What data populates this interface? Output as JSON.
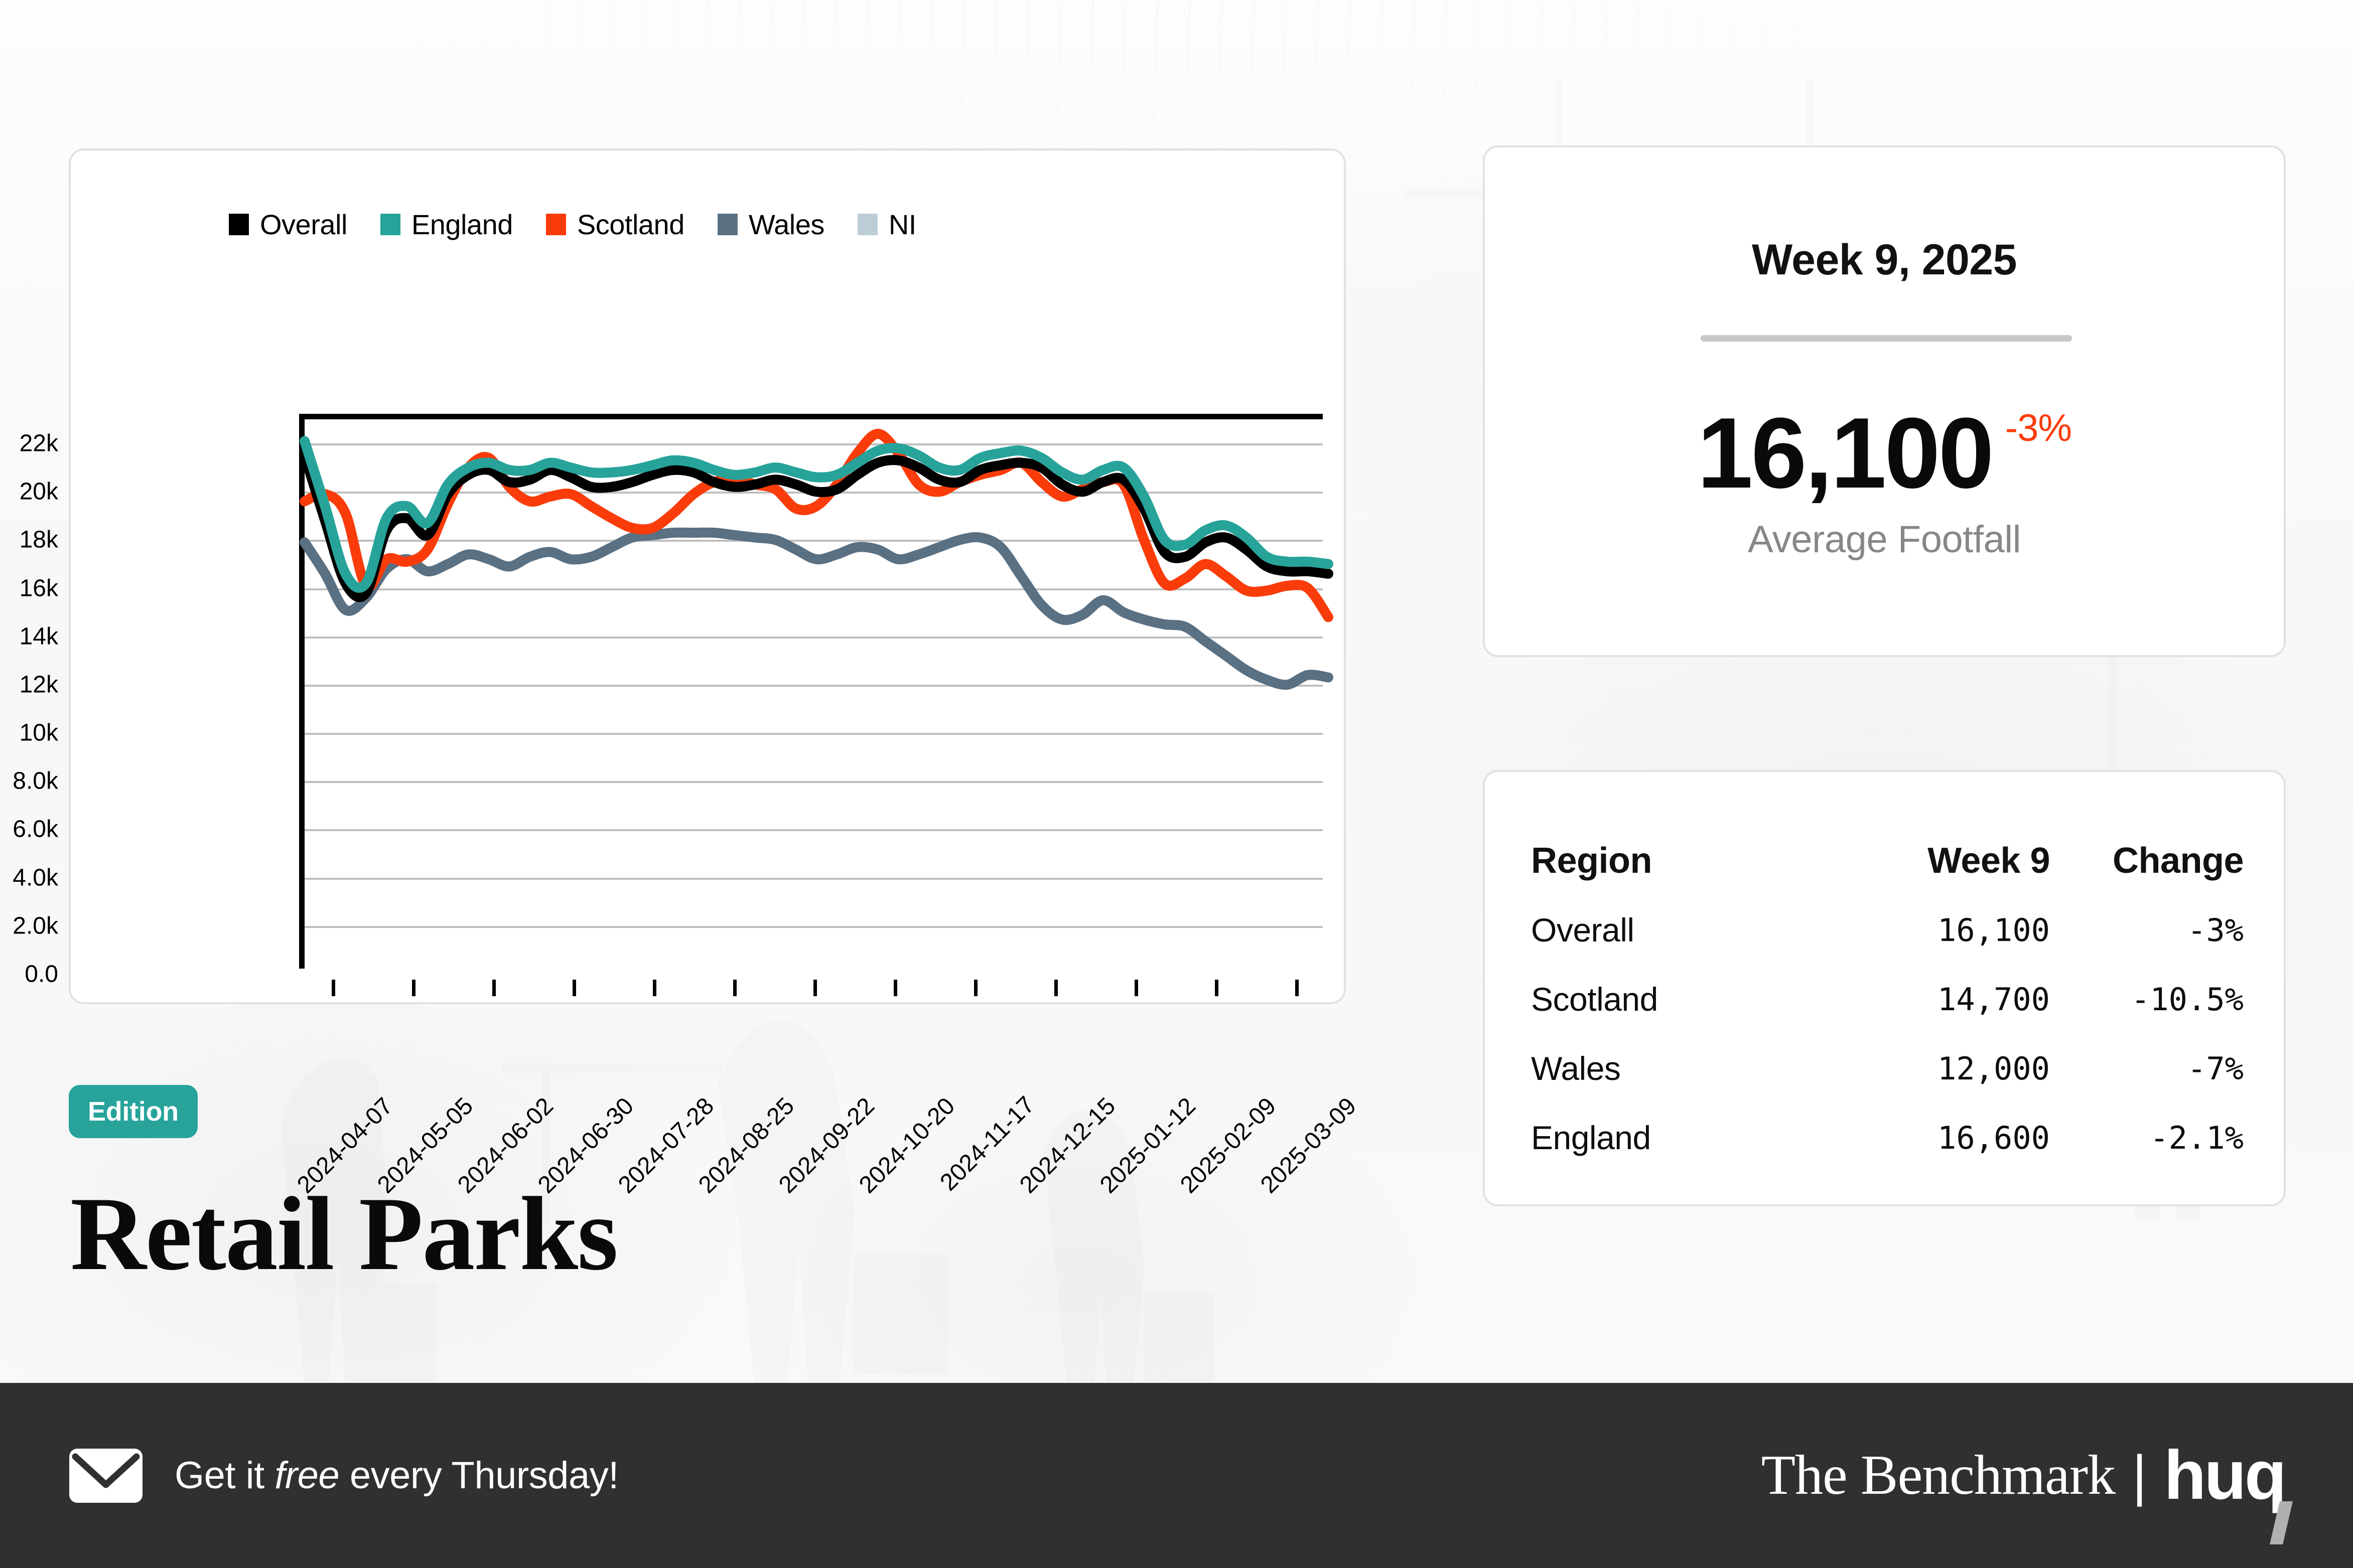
{
  "theme": {
    "teal": "#27a39a",
    "red": "#fa3c0a",
    "slate": "#5a7083",
    "light_blue": "#bccdd8",
    "black": "#000000",
    "footer_bg": "#2f3032",
    "muted_text": "#878787"
  },
  "edition": {
    "badge_label": "Edition",
    "title": "Retail Parks"
  },
  "kpi": {
    "week_label": "Week 9, 2025",
    "value": "16,100",
    "delta": "-3%",
    "caption": "Average Footfall"
  },
  "table": {
    "headers": [
      "Region",
      "Week 9",
      "Change"
    ],
    "rows": [
      {
        "region": "Overall",
        "value": "16,100",
        "change": "-3%"
      },
      {
        "region": "Scotland",
        "value": "14,700",
        "change": "-10.5%"
      },
      {
        "region": "Wales",
        "value": "12,000",
        "change": "-7%"
      },
      {
        "region": "England",
        "value": "16,600",
        "change": "-2.1%"
      }
    ]
  },
  "footer": {
    "cta_prefix": "Get it ",
    "cta_emphasis": "free",
    "cta_suffix": " every Thursday!",
    "brand_primary": "The Benchmark",
    "brand_separator": "|",
    "brand_secondary": "huq",
    "envelope_icon": "envelope-icon"
  },
  "chart_data": {
    "type": "line",
    "title": "",
    "xlabel": "",
    "ylabel": "",
    "grid": true,
    "legend_position": "top-left",
    "ylim": [
      0,
      23000
    ],
    "ytick_labels": [
      "0.0",
      "2.0k",
      "4.0k",
      "6.0k",
      "8.0k",
      "10k",
      "12k",
      "14k",
      "16k",
      "18k",
      "20k",
      "22k"
    ],
    "ytick_values": [
      0,
      2000,
      4000,
      6000,
      8000,
      10000,
      12000,
      14000,
      16000,
      18000,
      20000,
      22000
    ],
    "xtick_labels": [
      "2024-04-07",
      "2024-05-05",
      "2024-06-02",
      "2024-06-30",
      "2024-07-28",
      "2024-08-25",
      "2024-09-22",
      "2024-10-20",
      "2024-11-17",
      "2024-12-15",
      "2025-01-12",
      "2025-02-09",
      "2025-03-09"
    ],
    "x": [
      0,
      1,
      2,
      3,
      4,
      5,
      6,
      7,
      8,
      9,
      10,
      11,
      12,
      13,
      14,
      15,
      16,
      17,
      18,
      19,
      20,
      21,
      22,
      23,
      24,
      25,
      26,
      27,
      28,
      29,
      30,
      31,
      32,
      33,
      34,
      35,
      36,
      37,
      38,
      39,
      40,
      41,
      42,
      43,
      44,
      45,
      46,
      47,
      48,
      49,
      50
    ],
    "series": [
      {
        "name": "Overall",
        "color": "#000000",
        "values": [
          21500,
          18800,
          16200,
          15800,
          18400,
          18900,
          18200,
          19900,
          20700,
          20900,
          20400,
          20500,
          20900,
          20600,
          20200,
          20200,
          20400,
          20700,
          20900,
          20800,
          20400,
          20200,
          20300,
          20500,
          20300,
          20000,
          20100,
          20700,
          21200,
          21300,
          21000,
          20500,
          20400,
          20900,
          21100,
          21200,
          21000,
          20300,
          20000,
          20400,
          20500,
          19300,
          17500,
          17300,
          17900,
          18100,
          17600,
          16900,
          16700,
          16700,
          16600
        ]
      },
      {
        "name": "England",
        "color": "#27a39a",
        "values": [
          22100,
          19400,
          16600,
          16200,
          18900,
          19400,
          18700,
          20300,
          21000,
          21200,
          20900,
          20900,
          21200,
          21000,
          20800,
          20800,
          20900,
          21100,
          21300,
          21200,
          20900,
          20700,
          20800,
          21000,
          20800,
          20600,
          20700,
          21200,
          21700,
          21800,
          21500,
          21000,
          20900,
          21400,
          21600,
          21700,
          21400,
          20800,
          20500,
          20900,
          21000,
          19800,
          18000,
          17800,
          18400,
          18600,
          18100,
          17300,
          17100,
          17100,
          17000
        ]
      },
      {
        "name": "Scotland",
        "color": "#fa3c0a",
        "values": [
          19600,
          19900,
          19100,
          16100,
          17200,
          17100,
          17600,
          19500,
          21000,
          21400,
          20200,
          19600,
          19800,
          19900,
          19400,
          18900,
          18500,
          18500,
          19100,
          19900,
          20400,
          20500,
          20300,
          20100,
          19300,
          19400,
          20300,
          21600,
          22400,
          21600,
          20300,
          20000,
          20400,
          20700,
          20900,
          21200,
          20400,
          19800,
          20100,
          20400,
          20300,
          18000,
          16200,
          16400,
          17000,
          16500,
          15900,
          15900,
          16100,
          16000,
          14800
        ]
      },
      {
        "name": "Wales",
        "color": "#5a7083",
        "values": [
          17900,
          16600,
          15100,
          15600,
          16800,
          17200,
          16700,
          17000,
          17400,
          17200,
          16900,
          17300,
          17500,
          17200,
          17300,
          17700,
          18100,
          18200,
          18300,
          18300,
          18300,
          18200,
          18100,
          18000,
          17600,
          17200,
          17400,
          17700,
          17600,
          17200,
          17400,
          17700,
          18000,
          18100,
          17700,
          16500,
          15300,
          14700,
          14900,
          15500,
          15000,
          14700,
          14500,
          14400,
          13800,
          13200,
          12600,
          12200,
          12000,
          12400,
          12300
        ]
      },
      {
        "name": "NI",
        "color": "#bccdd8",
        "values": []
      }
    ]
  }
}
